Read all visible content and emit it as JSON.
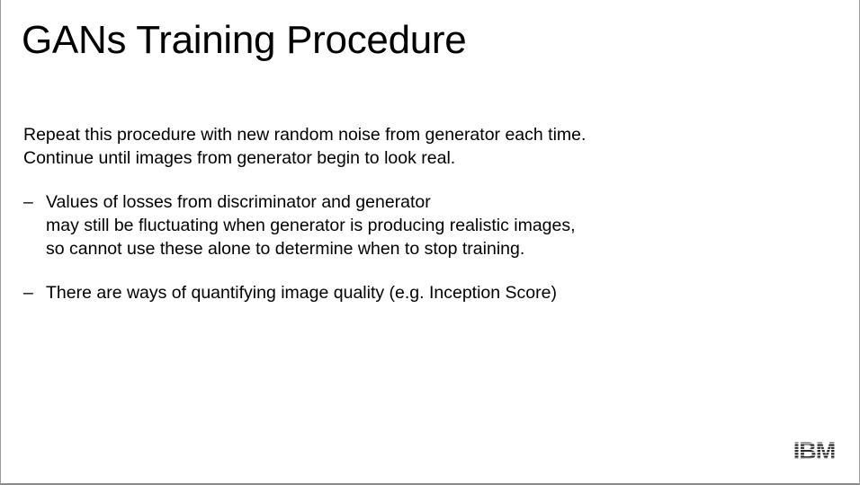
{
  "slide": {
    "title": "GANs Training Procedure",
    "intro_lines": [
      "Repeat this procedure with new random noise from generator each time.",
      "Continue until images from generator begin to look real."
    ],
    "bullets": [
      {
        "marker": "–",
        "lines": [
          "Values of losses from discriminator and generator",
          "may still be fluctuating when generator is producing realistic images,",
          "so cannot use these alone to determine when to stop training."
        ]
      },
      {
        "marker": "–",
        "lines": [
          "There are ways of quantifying image quality (e.g. Inception Score)"
        ]
      }
    ],
    "logo_text": "IBM"
  },
  "colors": {
    "text": "#000000",
    "background": "#ffffff",
    "logo": "#1f1f1f"
  }
}
